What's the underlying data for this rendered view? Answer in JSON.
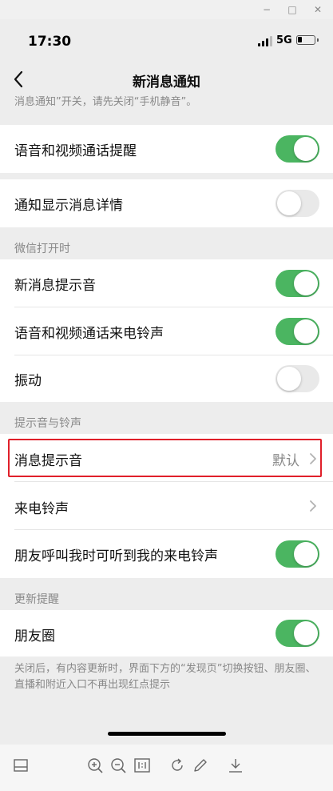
{
  "window": {
    "min_glyph": "−",
    "max_glyph": "□",
    "close_glyph": "✕"
  },
  "status_bar": {
    "time": "17:30",
    "network": "5G"
  },
  "nav": {
    "title": "新消息通知"
  },
  "cut_note": "消息通知”开关，请先关闭“手机静音”。",
  "rows": {
    "voice_video_reminder": {
      "label": "语音和视频通话提醒",
      "toggle": "on"
    },
    "show_details": {
      "label": "通知显示消息详情",
      "toggle": "off"
    },
    "new_message_sound": {
      "label": "新消息提示音",
      "toggle": "on"
    },
    "voice_video_ringtone": {
      "label": "语音和视频通话来电铃声",
      "toggle": "on"
    },
    "vibrate": {
      "label": "振动",
      "toggle": "off"
    },
    "message_sound": {
      "label": "消息提示音",
      "value": "默认"
    },
    "incoming_ringtone": {
      "label": "来电铃声"
    },
    "friend_call_ringtone": {
      "label": "朋友呼叫我时可听到我的来电铃声",
      "toggle": "on"
    },
    "moments": {
      "label": "朋友圈",
      "toggle": "on"
    }
  },
  "sections": {
    "wechat_open": "微信打开时",
    "sound_ringtone": "提示音与铃声",
    "update_reminder": "更新提醒"
  },
  "footer_note": "关闭后，有内容更新时，界面下方的“发现页”切换按钮、朋友圈、直播和附近入口不再出现红点提示",
  "colors": {
    "toggle_on": "#4bb561",
    "toggle_off": "#e9e9e9",
    "highlight": "#e0202a",
    "background": "#ededed"
  },
  "toolbar": {
    "icons": [
      "panel-icon",
      "zoom-in-icon",
      "zoom-out-icon",
      "actual-size-icon",
      "rotate-icon",
      "edit-icon",
      "download-icon"
    ]
  }
}
